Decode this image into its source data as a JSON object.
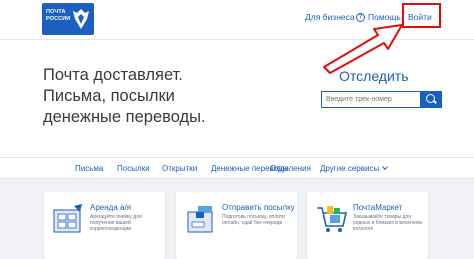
{
  "header": {
    "logo_line1": "ПОЧТА",
    "logo_line2": "РОССИИ",
    "business_link": "Для бизнеса",
    "help_link": "Помощь",
    "login_link": "Войти"
  },
  "hero": {
    "line1": "Почта доставляет.",
    "line2": "Письма, посылки",
    "line3": "денежные переводы."
  },
  "tracking": {
    "title": "Отследить",
    "placeholder": "Введите трек-номер"
  },
  "nav": {
    "items": [
      "Письма",
      "Посылки",
      "Открытки",
      "Денежные переводы",
      "Отделения",
      "Другие сервисы"
    ]
  },
  "cards": [
    {
      "title": "Аренда а/я",
      "description": "Арендуйте ячейку для получения вашей корреспонденции"
    },
    {
      "title": "Отправить посылку",
      "description": "Подготовь посылку, оплати онлайн, сдай без очереди"
    },
    {
      "title": "ПочтаМаркет",
      "description": "Заказывайте товары для родных и близких в весеннем каталоге"
    }
  ],
  "colors": {
    "brand_blue": "#1b5fc0",
    "highlight_red": "#e00d0d"
  }
}
